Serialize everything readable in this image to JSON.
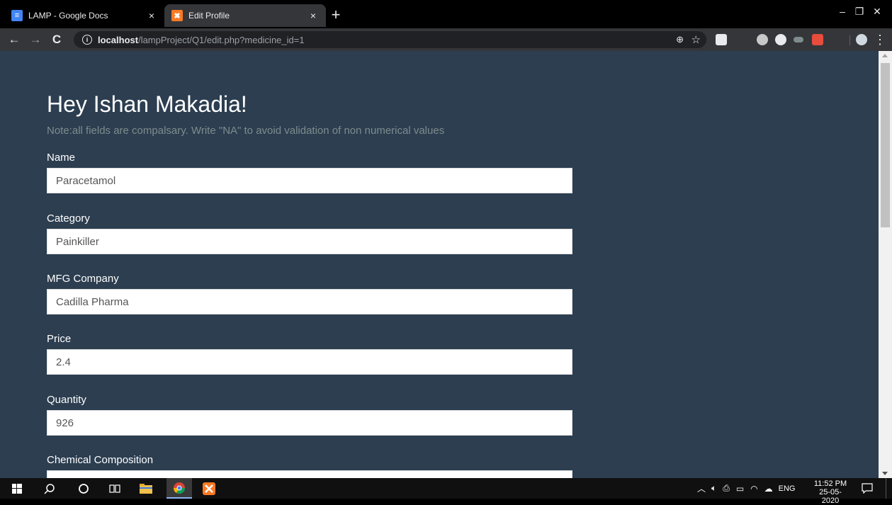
{
  "browser": {
    "tabs": [
      {
        "title": "LAMP - Google Docs",
        "icon": "google-docs-icon",
        "close": "×"
      },
      {
        "title": "Edit Profile",
        "icon": "xampp-icon",
        "close": "×"
      }
    ],
    "new_tab": "+",
    "window_controls": {
      "minimize": "–",
      "restore": "❐",
      "close": "✕"
    },
    "nav": {
      "back": "←",
      "forward": "→",
      "reload": "C"
    },
    "url": {
      "info": "i",
      "host": "localhost",
      "path": "/lampProject/Q1/edit.php?medicine_id=1"
    },
    "zoom_glyph": "⊕",
    "star_glyph": "☆",
    "menu_glyph": "⋮"
  },
  "page": {
    "greeting": "Hey Ishan Makadia!",
    "note": "Note:all fields are compalsary. Write \"NA\" to avoid validation of non numerical values",
    "fields": [
      {
        "label": "Name",
        "value": "Paracetamol"
      },
      {
        "label": "Category",
        "value": "Painkiller"
      },
      {
        "label": "MFG Company",
        "value": "Cadilla Pharma"
      },
      {
        "label": "Price",
        "value": "2.4"
      },
      {
        "label": "Quantity",
        "value": "926"
      },
      {
        "label": "Chemical Composition",
        "value": ""
      }
    ]
  },
  "taskbar": {
    "tray_lang": "ENG",
    "clock_time": "11:52 PM",
    "clock_date": "25-05-2020"
  },
  "colors": {
    "page_background": "#2c3e50",
    "label_text": "#ffffff",
    "note_text": "#7f8c8d",
    "input_background": "#ffffff"
  }
}
